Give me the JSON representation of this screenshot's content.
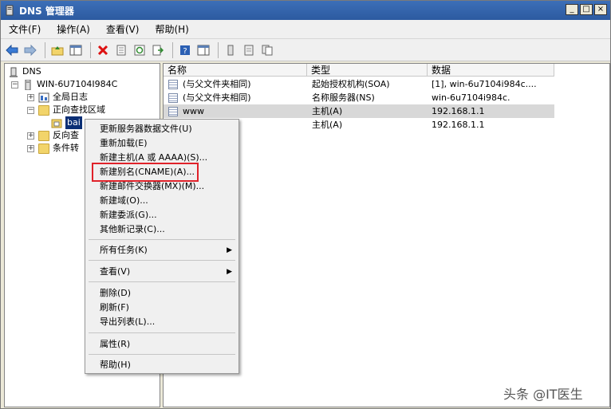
{
  "window": {
    "title": "DNS 管理器",
    "controls": [
      "_",
      "□",
      "×"
    ]
  },
  "menubar": [
    "文件(F)",
    "操作(A)",
    "查看(V)",
    "帮助(H)"
  ],
  "tree": {
    "root": "DNS",
    "server": "WIN-6U7104I984C",
    "global_logs": "全局日志",
    "forward_zones": "正向查找区域",
    "zone": "bai",
    "reverse_zones": "反向查",
    "conditional": "条件转"
  },
  "list": {
    "columns": [
      "名称",
      "类型",
      "数据"
    ],
    "rows": [
      {
        "name": "(与父文件夹相同)",
        "type": "起始授权机构(SOA)",
        "data": "[1], win-6u7104i984c...."
      },
      {
        "name": "(与父文件夹相同)",
        "type": "名称服务器(NS)",
        "data": "win-6u7104i984c."
      },
      {
        "name": "www",
        "type": "主机(A)",
        "data": "192.168.1.1"
      },
      {
        "name": "",
        "type": "主机(A)",
        "data": "192.168.1.1"
      }
    ]
  },
  "context_menu": {
    "items": [
      "更新服务器数据文件(U)",
      "重新加载(E)",
      "新建主机(A 或 AAAA)(S)...",
      "新建别名(CNAME)(A)...",
      "新建邮件交换器(MX)(M)...",
      "新建域(O)...",
      "新建委派(G)...",
      "其他新记录(C)...",
      "所有任务(K)",
      "查看(V)",
      "删除(D)",
      "刷新(F)",
      "导出列表(L)...",
      "属性(R)",
      "帮助(H)"
    ],
    "arrow": "▶"
  },
  "watermark": "头条 @IT医生",
  "colors": {
    "title_bar": "#2c5aa0",
    "selection": "#0b2f75",
    "highlight_box": "#e0222a"
  }
}
